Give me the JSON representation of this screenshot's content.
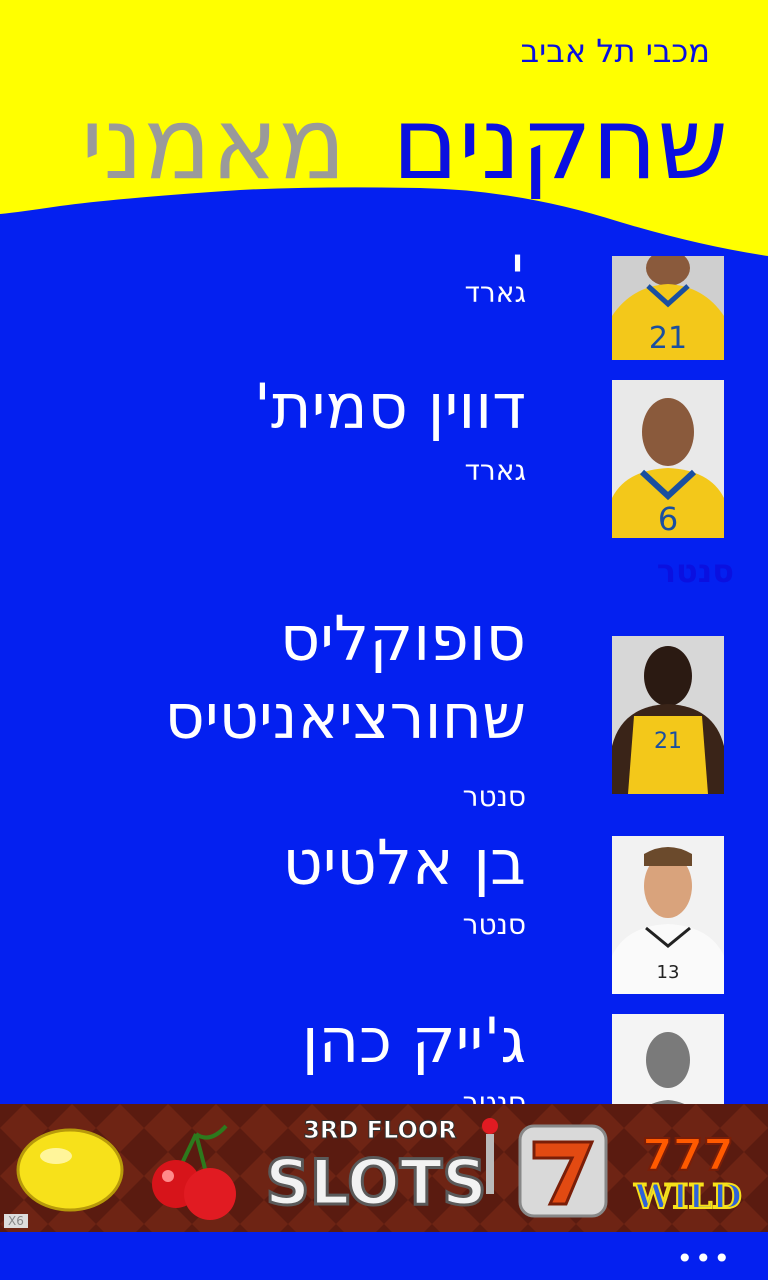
{
  "app": {
    "title": "מכבי תל אביב"
  },
  "pivot": {
    "active": "שחקנים",
    "inactive": "מאמני"
  },
  "players": [
    {
      "name": "'",
      "position": "גארד",
      "jersey": "21"
    },
    {
      "name": "דווין סמית'",
      "position": "גארד",
      "jersey": "6"
    },
    {
      "name": "סופוקליס\nשחורציאניטיס",
      "position": "סנטר",
      "jersey": "21"
    },
    {
      "name": "בן אלטיט",
      "position": "סנטר",
      "jersey": "13"
    },
    {
      "name": "ג'ייק כהן",
      "position": "סנטר",
      "jersey": ""
    }
  ],
  "group_header": "סנטר",
  "ad": {
    "brand": "3RD FLOOR",
    "title": "SLOTS",
    "badge_left": "X6",
    "wild_text": "WILD",
    "wild_num": "777"
  },
  "appbar": {
    "more": "•••"
  },
  "colors": {
    "background": "#0420f0",
    "header": "#ffff00",
    "accent": "#0a10e0"
  }
}
